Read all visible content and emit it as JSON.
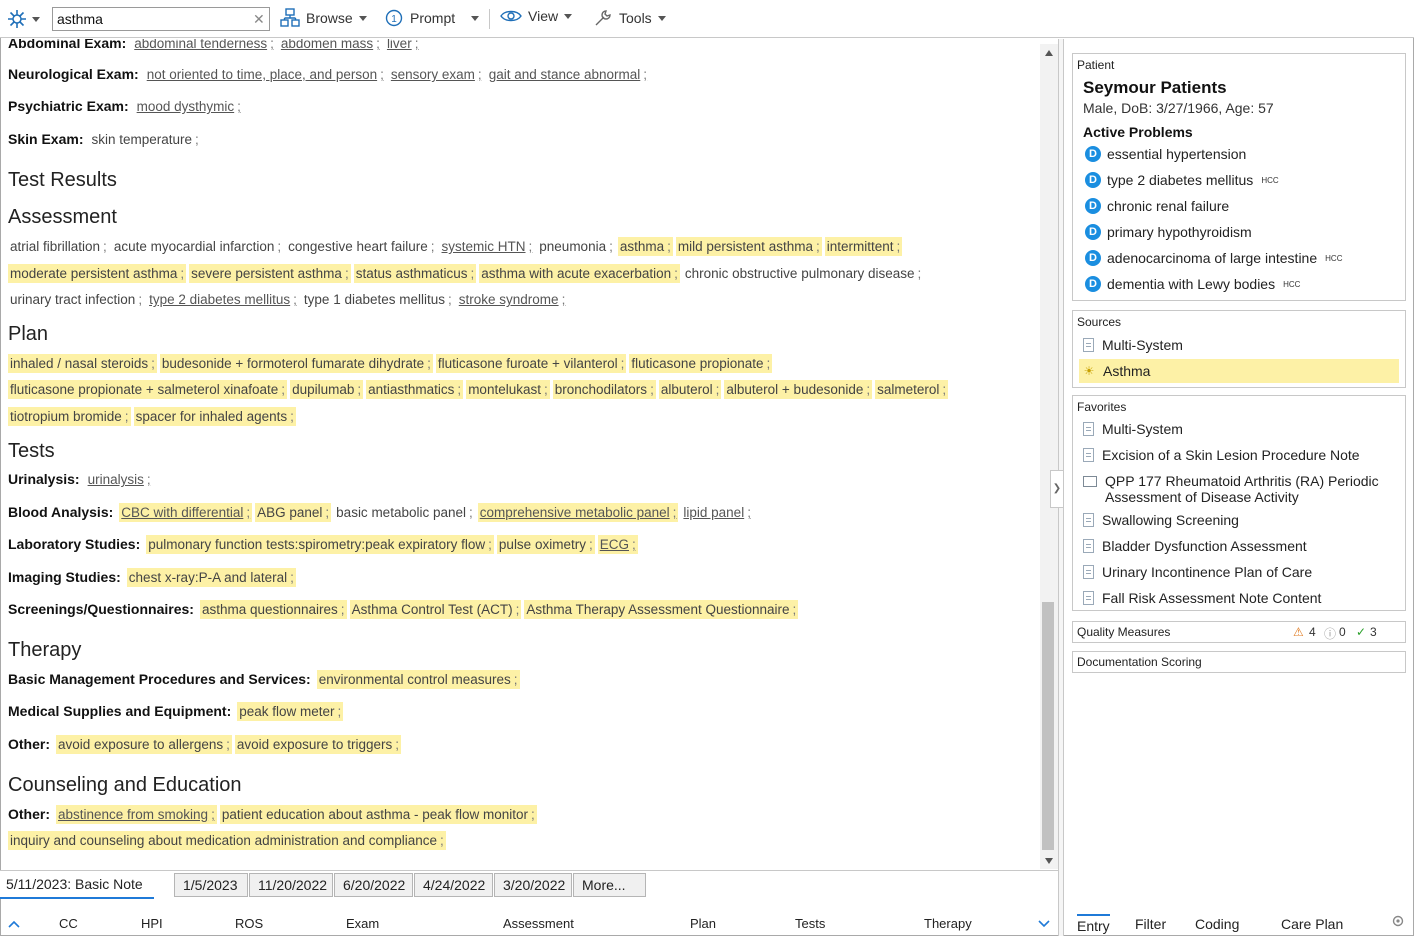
{
  "toolbar": {
    "search_value": "asthma",
    "browse": "Browse",
    "prompt": "Prompt",
    "view": "View",
    "tools": "Tools"
  },
  "note": {
    "abdominal_label": "Abdominal Exam:",
    "abdominal_items": [
      "abdominal tenderness",
      "abdomen mass",
      "liver"
    ],
    "neuro_label": "Neurological Exam:",
    "neuro_items": [
      "not oriented to time, place, and person",
      "sensory exam",
      "gait and stance abnormal"
    ],
    "psych_label": "Psychiatric Exam:",
    "psych_items": [
      "mood dysthymic"
    ],
    "skin_label": "Skin Exam:",
    "skin_items": [
      "skin temperature"
    ],
    "test_results_heading": "Test Results",
    "assessment_heading": "Assessment",
    "assessment_line1": [
      "atrial fibrillation",
      "acute myocardial infarction",
      "congestive heart failure",
      "systemic HTN",
      "pneumonia",
      "asthma",
      "mild persistent asthma",
      "intermittent"
    ],
    "assessment_line2": [
      "moderate persistent asthma",
      "severe persistent asthma",
      "status asthmaticus",
      "asthma with acute exacerbation",
      "chronic obstructive pulmonary disease"
    ],
    "assessment_line3": [
      "urinary tract infection",
      "type 2 diabetes mellitus",
      "type 1 diabetes mellitus",
      "stroke syndrome"
    ],
    "plan_heading": "Plan",
    "plan_line1": [
      "inhaled / nasal steroids",
      "budesonide + formoterol fumarate dihydrate",
      "fluticasone furoate + vilanterol",
      "fluticasone propionate"
    ],
    "plan_line2": [
      "fluticasone propionate + salmeterol xinafoate",
      "dupilumab",
      "antiasthmatics",
      "montelukast",
      "bronchodilators",
      "albuterol",
      "albuterol + budesonide",
      "salmeterol"
    ],
    "plan_line3": [
      "tiotropium bromide",
      "spacer for inhaled agents"
    ],
    "tests_heading": "Tests",
    "urinalysis_label": "Urinalysis:",
    "urinalysis_items": [
      "urinalysis"
    ],
    "blood_label": "Blood Analysis:",
    "blood_items": [
      "CBC with differential",
      "ABG panel",
      "basic metabolic panel",
      "comprehensive metabolic panel",
      "lipid panel"
    ],
    "lab_label": "Laboratory Studies:",
    "lab_items": [
      "pulmonary function tests:spirometry:peak expiratory flow",
      "pulse oximetry",
      "ECG"
    ],
    "imaging_label": "Imaging Studies:",
    "imaging_items": [
      "chest x-ray:P-A and lateral"
    ],
    "screen_label": "Screenings/Questionnaires:",
    "screen_items": [
      "asthma questionnaires",
      "Asthma Control Test (ACT)",
      "Asthma Therapy Assessment Questionnaire"
    ],
    "therapy_heading": "Therapy",
    "basic_label": "Basic Management Procedures and Services:",
    "basic_items": [
      "environmental control measures"
    ],
    "supplies_label": "Medical Supplies and Equipment:",
    "supplies_items": [
      "peak flow meter"
    ],
    "other_label": "Other:",
    "other_items": [
      "avoid exposure to allergens",
      "avoid exposure to triggers"
    ],
    "counsel_heading": "Counseling and Education",
    "counsel_label": "Other:",
    "counsel_line1": [
      "abstinence from smoking",
      "patient education about asthma - peak flow monitor"
    ],
    "counsel_line2": [
      "inquiry and counseling about medication administration and compliance"
    ]
  },
  "date_tabs": {
    "active": "5/11/2023: Basic Note",
    "others": [
      "1/5/2023",
      "11/20/2022",
      "6/20/2022",
      "4/24/2022",
      "3/20/2022",
      "More..."
    ]
  },
  "section_nav": [
    "CC",
    "HPI",
    "ROS",
    "Exam",
    "Assessment",
    "Plan",
    "Tests",
    "Therapy"
  ],
  "patient": {
    "panel_title": "Patient",
    "name": "Seymour Patients",
    "info": "Male, DoB: 3/27/1966, Age: 57",
    "active_problems_heading": "Active Problems",
    "problems": [
      {
        "label": "essential hypertension",
        "hcc": ""
      },
      {
        "label": "type 2 diabetes mellitus",
        "hcc": "HCC"
      },
      {
        "label": "chronic renal failure",
        "hcc": ""
      },
      {
        "label": "primary hypothyroidism",
        "hcc": ""
      },
      {
        "label": "adenocarcinoma of large intestine",
        "hcc": "HCC"
      },
      {
        "label": "dementia with Lewy bodies",
        "hcc": "HCC"
      }
    ]
  },
  "sources": {
    "title": "Sources",
    "items": [
      "Multi-System",
      "Asthma"
    ]
  },
  "favorites": {
    "title": "Favorites",
    "items": [
      "Multi-System",
      "Excision of a Skin Lesion Procedure Note",
      "QPP 177 Rheumatoid Arthritis (RA) Periodic Assessment of Disease Activity",
      "Swallowing Screening",
      "Bladder Dysfunction Assessment",
      "Urinary Incontinence Plan of Care",
      "Fall Risk Assessment Note Content"
    ]
  },
  "quality": {
    "title": "Quality Measures",
    "warn": "4",
    "info": "0",
    "ok": "3"
  },
  "scoring_title": "Documentation Scoring",
  "side_tabs": [
    "Entry",
    "Filter",
    "Coding",
    "Care Plan"
  ],
  "colors": {
    "highlight": "#fdf1a6",
    "accent": "#1f7ad8",
    "problem_icon": "#1a8ee0"
  }
}
